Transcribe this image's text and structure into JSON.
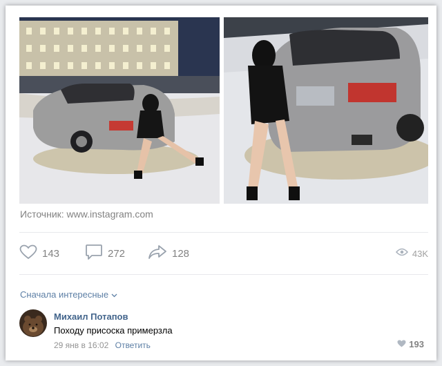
{
  "post": {
    "source_label": "Источник:",
    "source_url": "www.instagram.com",
    "photos": [
      {
        "icon": "photo-woman-car-night"
      },
      {
        "icon": "photo-woman-car-closeup"
      }
    ]
  },
  "actions": {
    "likes": "143",
    "comments": "272",
    "shares": "128",
    "views": "43K"
  },
  "comments": {
    "sort_label": "Сначала интересные",
    "items": [
      {
        "author": "Михаил Потапов",
        "text": "Походу присоска примерзла",
        "date": "29 янв в 16:02",
        "reply_label": "Ответить",
        "likes": "193"
      }
    ]
  },
  "colors": {
    "link": "#42648b",
    "secondary": "#828282",
    "background": "#e9ebee"
  }
}
